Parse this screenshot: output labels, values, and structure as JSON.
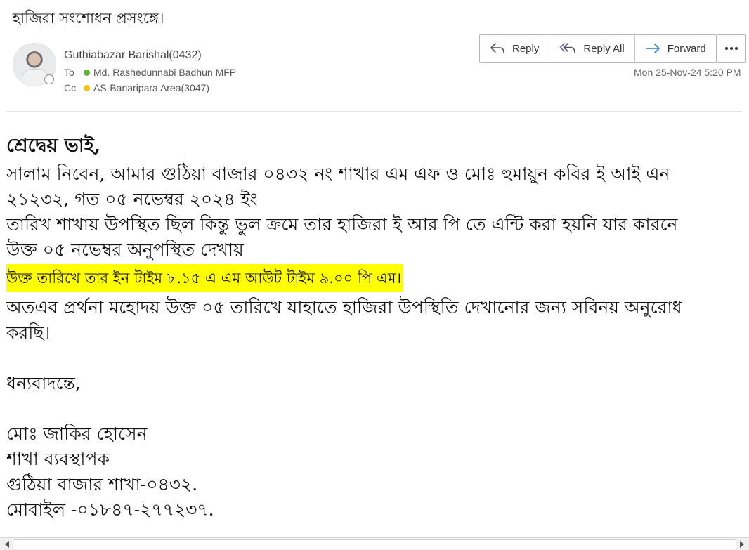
{
  "subject": "হাজিরা সংশোধন প্রসংঙ্গে।",
  "sender": {
    "name": "Guthiabazar Barishal(0432)"
  },
  "to": {
    "label": "To",
    "name": "Md. Rashedunnabi Badhun MFP",
    "status_color": "#5cb531"
  },
  "cc": {
    "label": "Cc",
    "name": "AS-Banaripara Area(3047)",
    "status_color": "#f3c317"
  },
  "actions": {
    "reply": "Reply",
    "reply_all": "Reply All",
    "forward": "Forward",
    "more_icon": "ellipsis-icon"
  },
  "timestamp": "Mon 25-Nov-24 5:20 PM",
  "body": {
    "greeting": "শ্রেদ্বেয় ভাই,",
    "line1": "সালাম নিবেন, আমার গুঠিয়া বাজার ০৪৩২ নং শাখার এম এফ ও মোঃ হুমায়ুন কবির ই আই এন",
    "line2": "২১২৩২, গত ০৫ নভেম্বর ২০২৪ ইং",
    "line3": "তারিখ শাখায় উপস্থিত ছিল কিন্তু ভুল ক্রমে তার হাজিরা ই আর পি তে এন্টি করা হয়নি  যার কারনে",
    "line4": "উক্ত ০৫ নভেম্বর অনুপস্থিত দেখায়",
    "highlight": "উক্ত তারিখে তার ইন টাইম ৮.১৫ এ এম আউট টাইম ৯.০০ পি এম।",
    "highlight_color": "#ffff00",
    "line5": "অতএব প্রর্থনা মহোদয় উক্ত ০৫ তারিখে যাহাতে হাজিরা উপস্থিতি দেখানোর জন্য সবিনয় অনুরোধ",
    "line6": "করছি।",
    "closing": "ধন্যবাদন্তে,",
    "sig_name": "মোঃ জাকির হোসেন",
    "sig_title": "শাখা ব্যবস্থাপক",
    "sig_branch": "গুঠিয়া বাজার শাখা-০৪৩২.",
    "sig_mobile": "মোবাইল -০১৮৪৭-২৭৭২৩৭."
  }
}
